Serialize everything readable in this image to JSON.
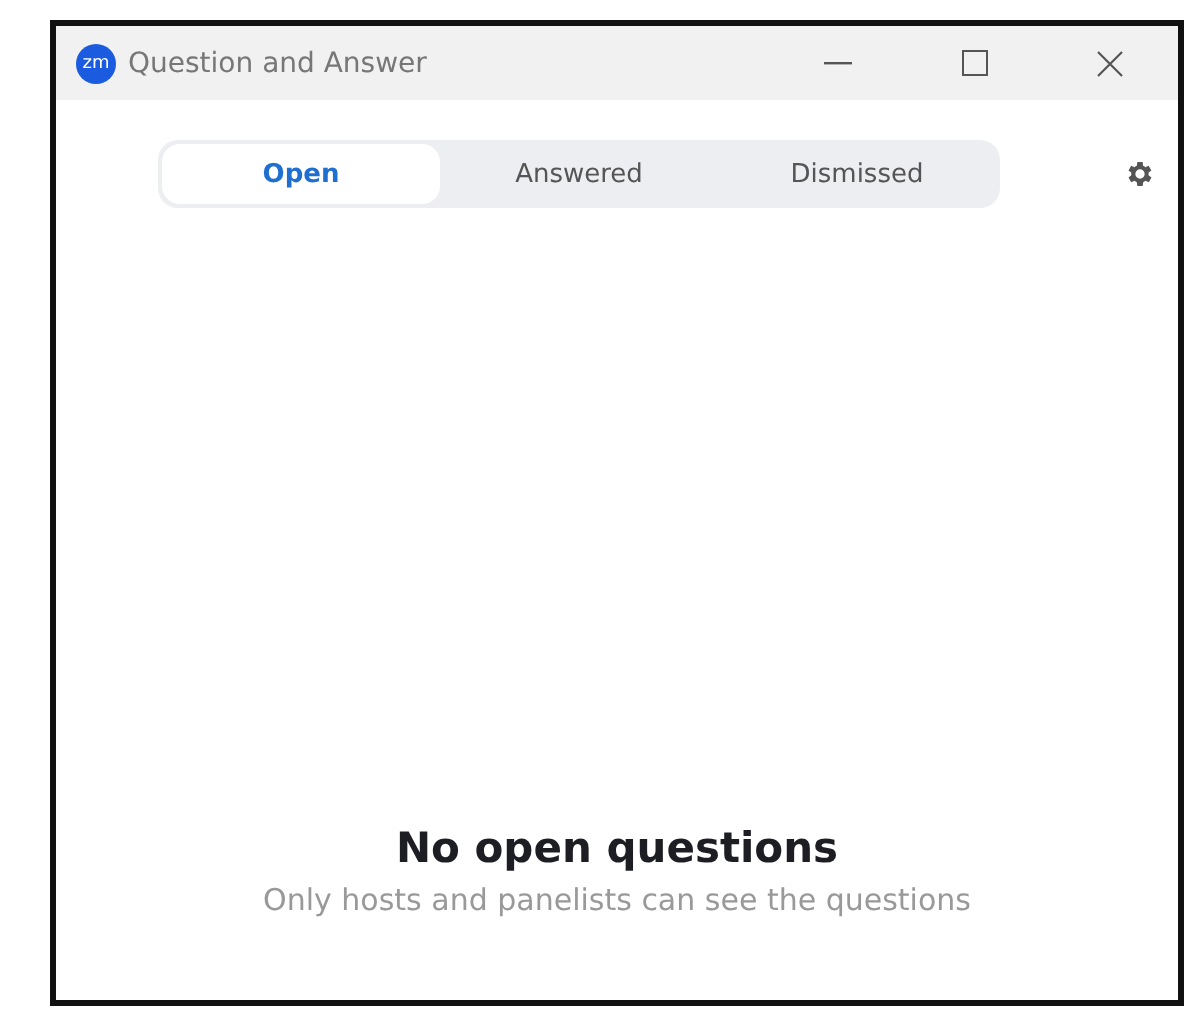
{
  "window": {
    "logo": "zm",
    "title": "Question and Answer"
  },
  "tabs": [
    {
      "label": "Open",
      "selected": true
    },
    {
      "label": "Answered",
      "selected": false
    },
    {
      "label": "Dismissed",
      "selected": false
    }
  ],
  "empty_state": {
    "heading": "No open questions",
    "message": "Only hosts and panelists can see the questions"
  }
}
